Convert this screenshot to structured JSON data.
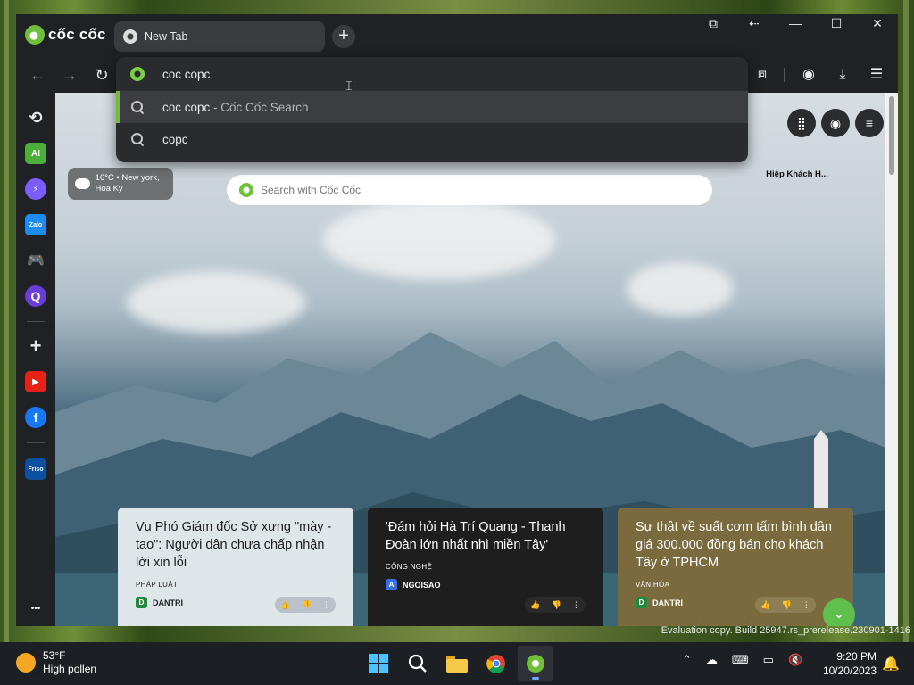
{
  "browser": {
    "logo_text": "cốc cốc",
    "tab_title": "New Tab",
    "new_tab": "+",
    "window_controls": [
      "⧉",
      "⇠",
      "—",
      "☐",
      "✕"
    ]
  },
  "omnibox": {
    "value": "coc copc",
    "suggestions": [
      {
        "text": "coc copc",
        "suffix": " - Cốc Cốc Search"
      },
      {
        "text": "copc",
        "suffix": ""
      }
    ]
  },
  "sidebar": {
    "items": [
      {
        "name": "history",
        "glyph": "⟲"
      },
      {
        "name": "ai",
        "glyph": "AI"
      },
      {
        "name": "messenger",
        "glyph": "⚡"
      },
      {
        "name": "zalo",
        "glyph": "Zalo"
      },
      {
        "name": "games",
        "glyph": "🎮"
      },
      {
        "name": "q-app",
        "glyph": "Q"
      },
      {
        "name": "add",
        "glyph": "+"
      },
      {
        "name": "youtube",
        "glyph": "▶"
      },
      {
        "name": "facebook",
        "glyph": "f"
      },
      {
        "name": "friso",
        "glyph": "Friso"
      },
      {
        "name": "more",
        "glyph": "•••"
      }
    ]
  },
  "newtab": {
    "weather": "16°C • New york, Hoa Kỳ",
    "search_placeholder": "Search with Cốc Cốc",
    "profile_label": "Hiệp Khách H...",
    "cards": [
      {
        "title": "Vụ Phó Giám đốc Sở xưng \"mày - tao\": Người dân chưa chấp nhận lời xin lỗi",
        "category": "PHÁP LUẬT",
        "source": "DANTRI",
        "bg": "#dfe6ea",
        "fg": "#1b1b1b"
      },
      {
        "title": "'Đám hỏi Hà Trí Quang - Thanh Đoàn lớn nhất nhì miền Tây'",
        "category": "CÔNG NGHỆ",
        "source": "NGOISAO",
        "bg": "#1e1e1f",
        "fg": "#ffffff"
      },
      {
        "title": "Sự thật về suất cơm tấm bình dân giá 300.000 đồng bán cho khách Tây ở TPHCM",
        "category": "VĂN HÓA",
        "source": "DANTRI",
        "bg": "#7b6a3e",
        "fg": "#ffffff"
      }
    ]
  },
  "watermark": "Evaluation copy. Build 25947.rs_prerelease.230901-1416",
  "taskbar": {
    "temp": "53°F",
    "weather_desc": "High pollen",
    "time": "9:20 PM",
    "date": "10/20/2023"
  },
  "colors": {
    "accent": "#6fbf3a",
    "scroll_button": "#5fc04e",
    "chrome_bg": "#202124"
  }
}
